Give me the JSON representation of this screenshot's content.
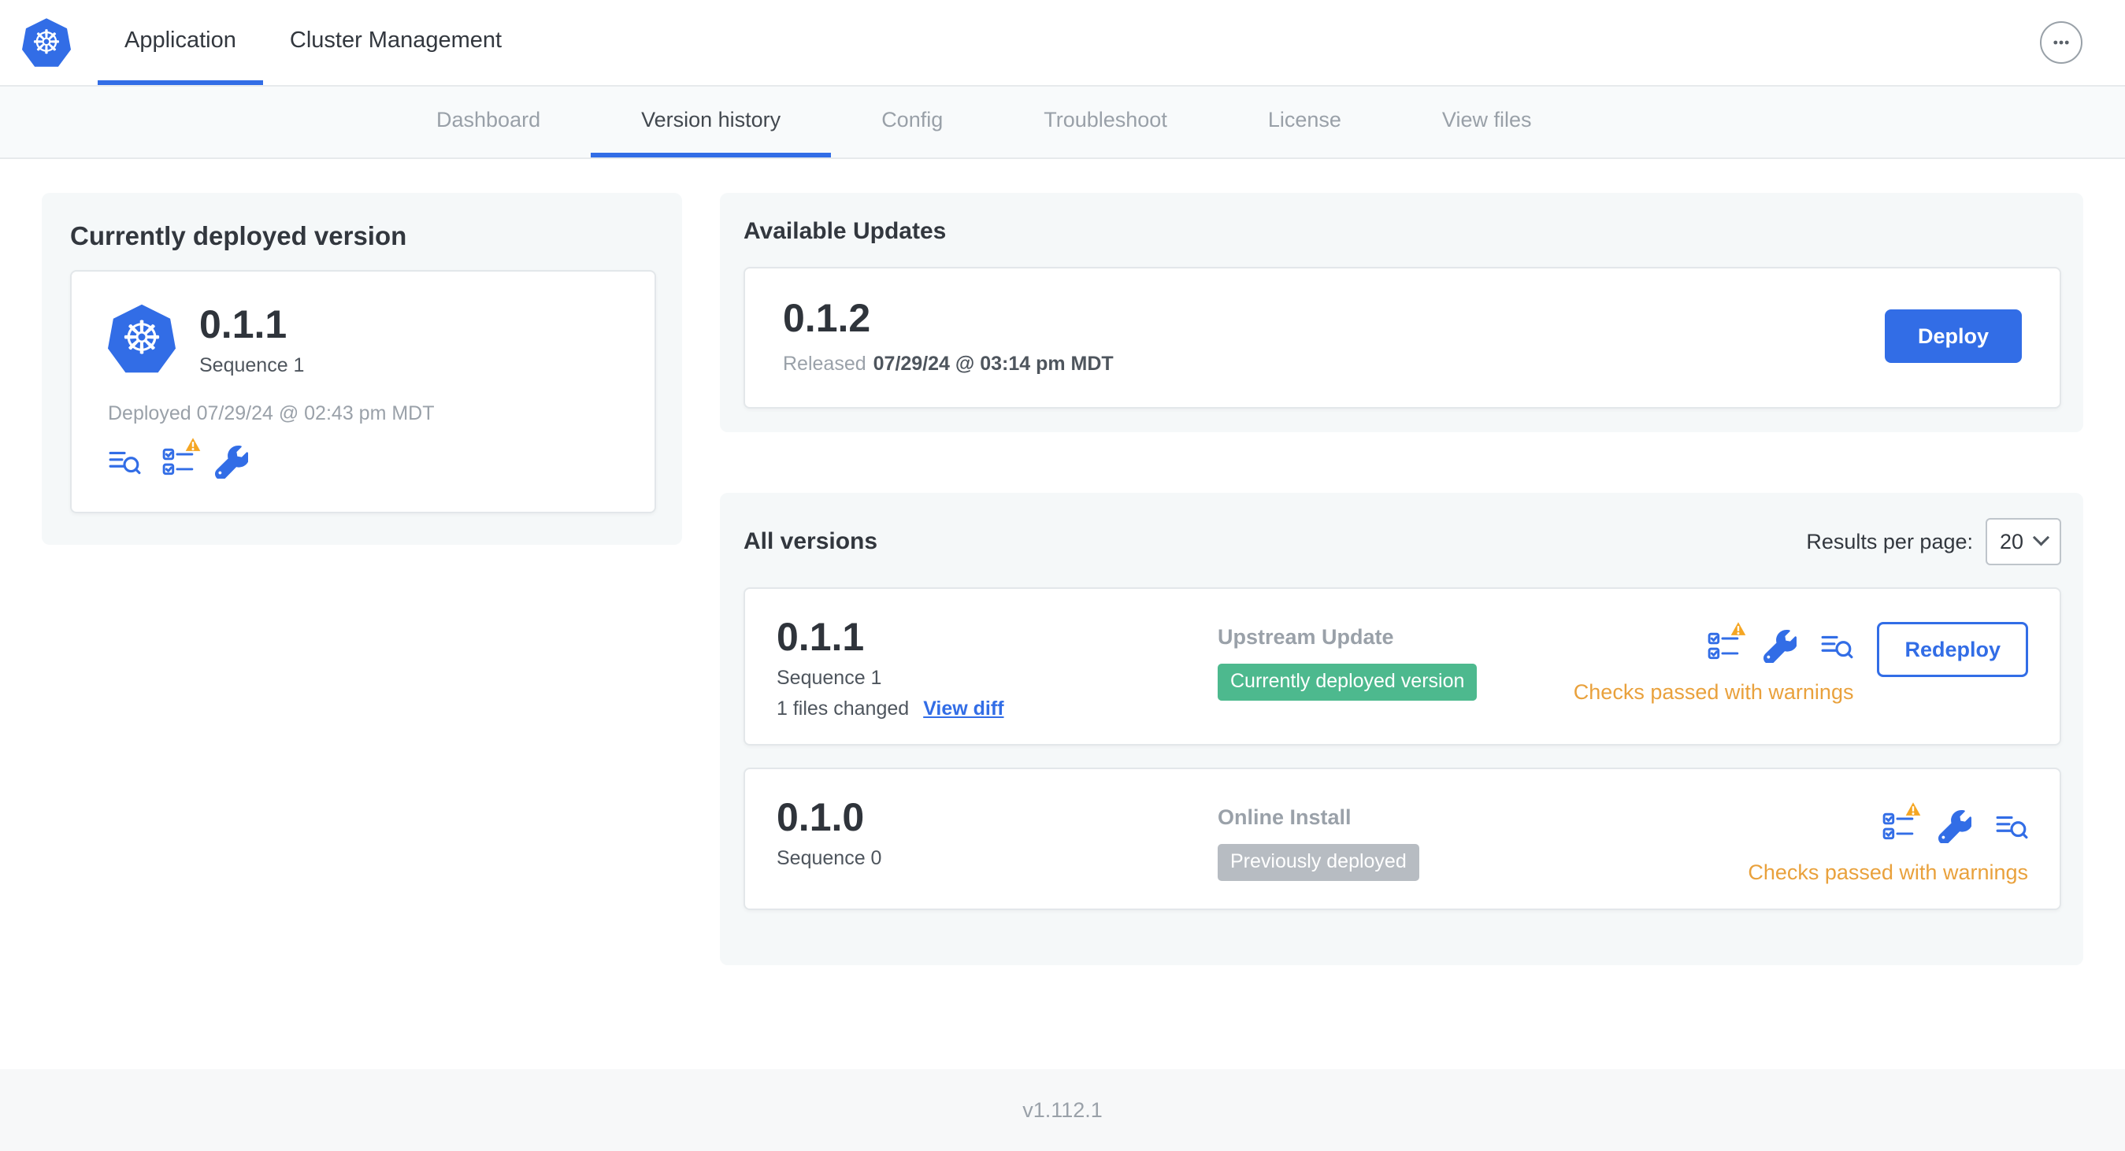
{
  "colors": {
    "primary_blue": "#326de6",
    "badge_green": "#4db98e",
    "badge_gray": "#b7bcc2",
    "warning_text_orange": "#e9a13c",
    "warning_triangle": "#f5a623"
  },
  "icons": {
    "logo": "kubernetes-helm-wheel",
    "logo_glyph": "☸",
    "menu": "ellipsis",
    "deploy_logs": "lines-with-magnifier",
    "preflight_checks": "checklist-with-warning",
    "edit_config": "wrench",
    "select_chevron": "chevron-down"
  },
  "topnav": {
    "tabs": [
      {
        "label": "Application"
      },
      {
        "label": "Cluster Management"
      }
    ]
  },
  "subnav": {
    "tabs": [
      {
        "label": "Dashboard"
      },
      {
        "label": "Version history"
      },
      {
        "label": "Config"
      },
      {
        "label": "Troubleshoot"
      },
      {
        "label": "License"
      },
      {
        "label": "View files"
      }
    ]
  },
  "current_version": {
    "title": "Currently deployed version",
    "version": "0.1.1",
    "sequence": "Sequence 1",
    "deployed": "Deployed 07/29/24 @ 02:43 pm MDT"
  },
  "available_updates": {
    "title": "Available Updates",
    "version": "0.1.2",
    "released_prefix": "Released",
    "released_date": "07/29/24 @ 03:14 pm MDT",
    "deploy_label": "Deploy"
  },
  "all_versions": {
    "title": "All versions",
    "results_per_page_label": "Results per page:",
    "results_per_page_value": "20",
    "rows": [
      {
        "version": "0.1.1",
        "sequence": "Sequence 1",
        "files_changed": "1 files changed",
        "view_diff": "View diff",
        "source": "Upstream Update",
        "badge": "Currently deployed version",
        "badge_style": "background-color:#4db98e",
        "status": "Checks passed with warnings",
        "action": "Redeploy"
      },
      {
        "version": "0.1.0",
        "sequence": "Sequence 0",
        "source": "Online Install",
        "badge": "Previously deployed",
        "badge_style": "background-color:#b7bcc2",
        "status": "Checks passed with warnings"
      }
    ]
  },
  "footer": {
    "version": "v1.112.1"
  }
}
